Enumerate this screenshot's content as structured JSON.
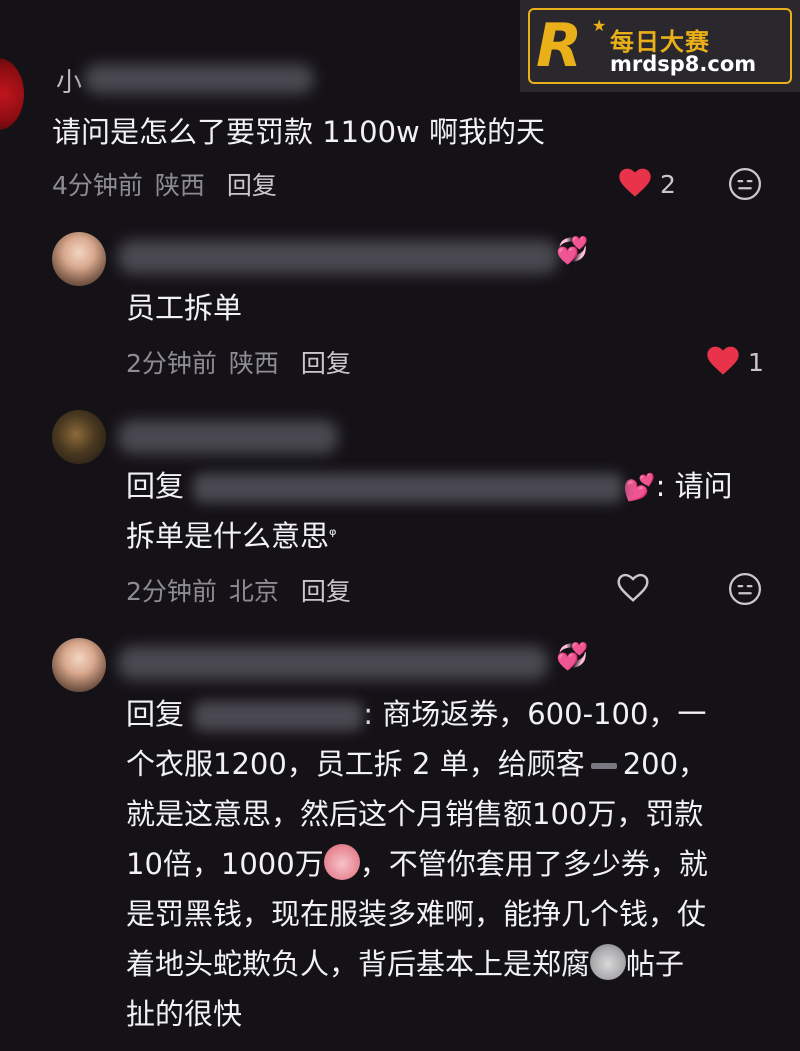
{
  "watermark": {
    "logo_letter": "R",
    "brand_cn": "每日大赛",
    "url": "mrdsp8.com"
  },
  "comments": [
    {
      "username_partial": "小",
      "text": "请问是怎么了要罚款 1100w 啊我的天",
      "time": "4分钟前",
      "location": "陕西",
      "reply_label": "回复",
      "likes": "2"
    },
    {
      "username_partial": "",
      "text": "员工拆单",
      "time": "2分钟前",
      "location": "陕西",
      "reply_label": "回复",
      "likes": "1"
    },
    {
      "username_partial": "",
      "reply_prefix": "回复",
      "reply_suffix": ": 请问",
      "text_line2": "拆单是什么意思",
      "search_mark": "ᵠ",
      "time": "2分钟前",
      "location": "北京",
      "reply_label": "回复"
    },
    {
      "username_partial": "",
      "reply_prefix": "回复",
      "lines": [
        ": 商场返券，600-100，一",
        "个衣服1200，员工拆 2 单，给顾客",
        "200，",
        "就是这意思，然后这个月销售额100万，罚款",
        "10倍，1000万",
        "，不管你套用了多少券，就",
        "是罚黑钱，现在服装多难啊，能挣几个钱，仗",
        "着地头蛇欺负人，背后基本上是郑腐",
        "帖子",
        "扯的很快"
      ]
    }
  ],
  "colors": {
    "background": "#141217",
    "heart": "#e8334a",
    "meta_text": "#8e8c93",
    "watermark_gold": "#e9b019"
  },
  "icons": {
    "like_filled": "heart-filled-icon",
    "like_outline": "heart-outline-icon",
    "emoji": "emoji-face-icon",
    "sticker": "sparkling-hearts-icon"
  }
}
